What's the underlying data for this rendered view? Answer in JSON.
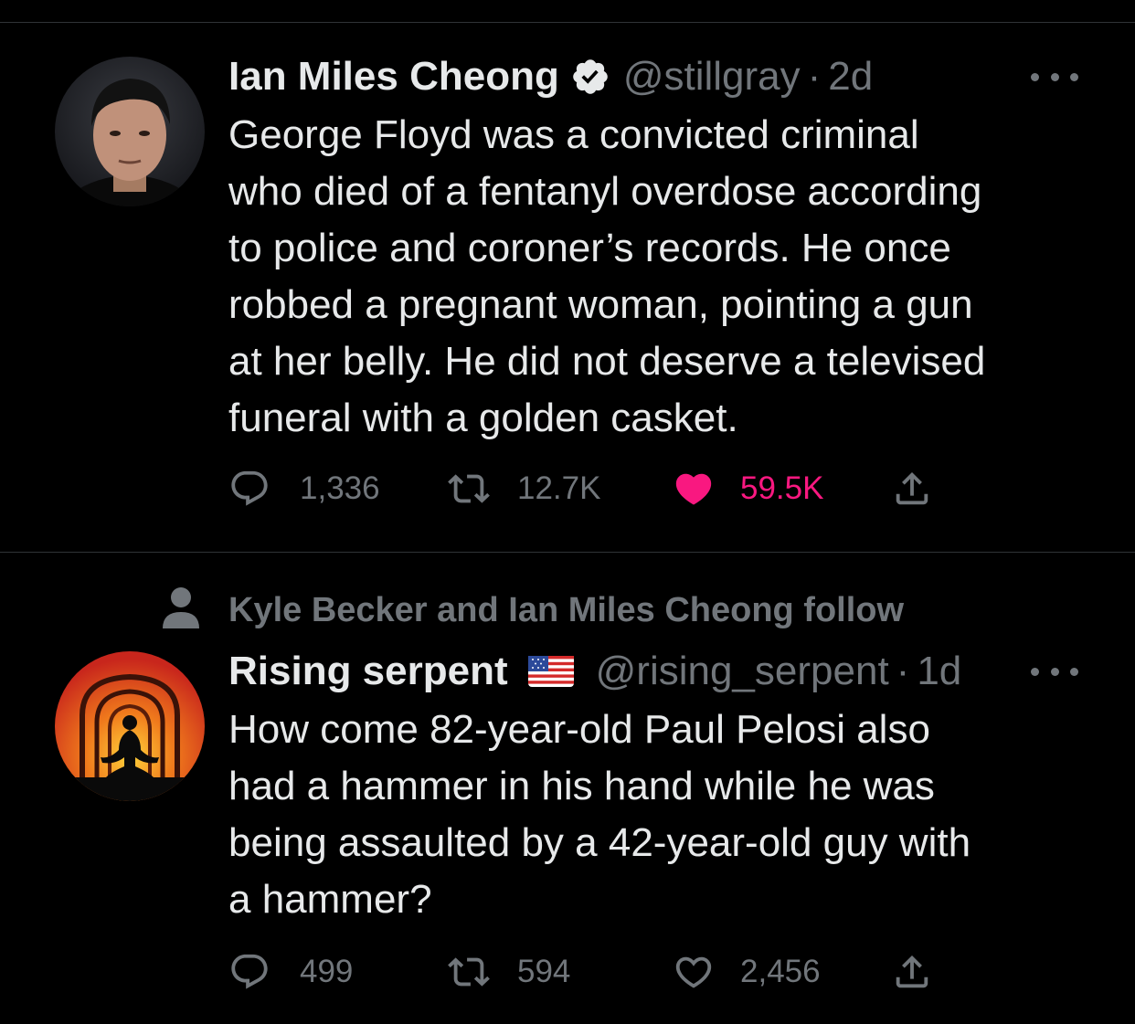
{
  "tweets": [
    {
      "display_name": "Ian Miles Cheong",
      "verified": true,
      "handle": "@stillgray",
      "separator": "·",
      "time": "2d",
      "text": "George Floyd was a convicted criminal\nwho died of a fentanyl overdose according\nto police and coroner’s records. He once\nrobbed a pregnant woman, pointing a gun\nat her belly. He did not deserve a televised\nfuneral with a golden casket.",
      "replies": "1,336",
      "retweets": "12.7K",
      "likes": "59.5K",
      "liked": true
    },
    {
      "social_context": "Kyle Becker and Ian Miles Cheong follow",
      "display_name": "Rising serpent",
      "flag": "us-flag",
      "handle": "@rising_serpent",
      "separator": "·",
      "time": "1d",
      "text": "How come 82-year-old Paul Pelosi also\nhad a hammer in his hand while he was\nbeing assaulted by a 42-year-old guy with\na hammer?",
      "replies": "499",
      "retweets": "594",
      "likes": "2,456",
      "liked": false
    }
  ],
  "colors": {
    "background": "#000000",
    "text": "#e7e9ea",
    "muted": "#71767b",
    "like": "#f91880",
    "divider": "#2f3336"
  }
}
